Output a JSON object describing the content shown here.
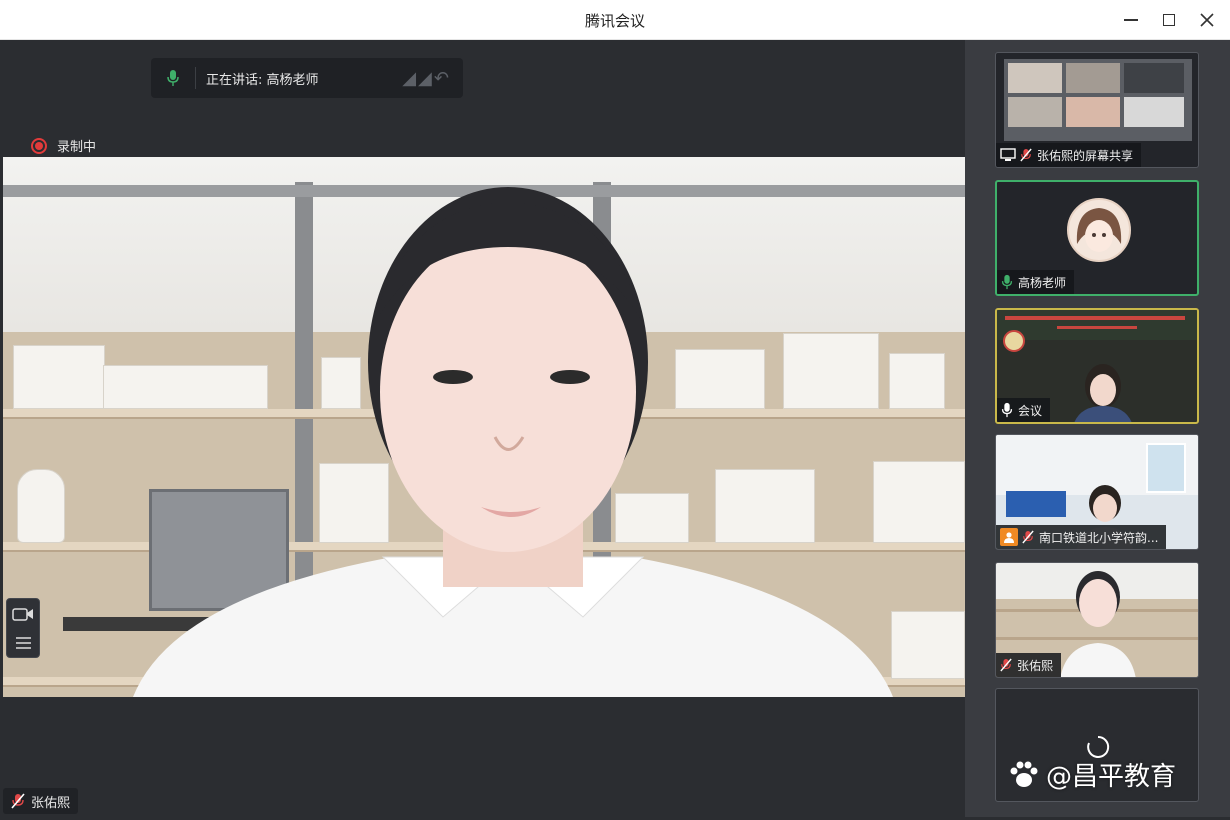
{
  "window": {
    "title": "腾讯会议"
  },
  "speaking": {
    "label": "正在讲话: 高杨老师"
  },
  "recording": {
    "label": "录制中"
  },
  "main_video": {
    "participant_name": "张佑熙"
  },
  "sidebar": {
    "tiles": [
      {
        "name": "张佑熙的屏幕共享",
        "type": "screen-share",
        "active": false
      },
      {
        "name": "高杨老师",
        "type": "avatar",
        "active": true
      },
      {
        "name": "会议",
        "type": "video",
        "active": false
      },
      {
        "name": "南口铁道北小学符韵...",
        "type": "video",
        "active": false
      },
      {
        "name": "张佑熙",
        "type": "video",
        "active": false
      },
      {
        "name": "",
        "type": "loading",
        "active": false
      }
    ]
  },
  "watermark": {
    "text": "@昌平教育"
  },
  "colors": {
    "accent_green": "#3fb06a",
    "record_red": "#e23b3b",
    "mic_muted_red": "#e04848"
  }
}
